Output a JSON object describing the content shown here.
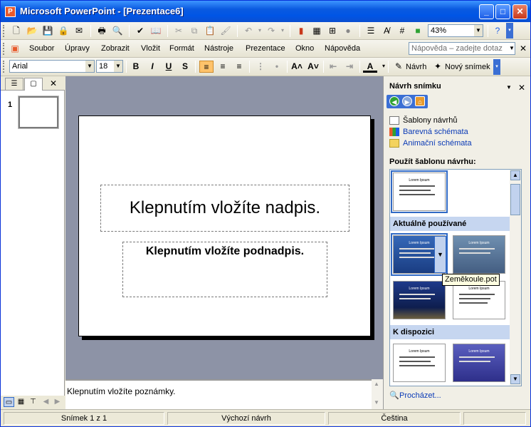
{
  "window": {
    "title": "Microsoft PowerPoint - [Prezentace6]",
    "app_icon": "P"
  },
  "standard_toolbar": {
    "zoom": "43%"
  },
  "menu": {
    "items": [
      "Soubor",
      "Úpravy",
      "Zobrazit",
      "Vložit",
      "Formát",
      "Nástroje",
      "Prezentace",
      "Okno",
      "Nápověda"
    ],
    "help_placeholder": "Nápověda – zadejte dotaz"
  },
  "format_toolbar": {
    "font": "Arial",
    "size": "18",
    "bold": "B",
    "italic": "I",
    "underline": "U",
    "shadow": "S",
    "design_label": "Návrh",
    "new_slide_label": "Nový snímek"
  },
  "slides_pane": {
    "slide_number": "1"
  },
  "slide": {
    "title_placeholder": "Klepnutím vložíte nadpis.",
    "subtitle_placeholder": "Klepnutím vložíte podnadpis."
  },
  "notes": {
    "placeholder": "Klepnutím vložíte poznámky."
  },
  "task_pane": {
    "title": "Návrh snímku",
    "links": [
      "Šablony návrhů",
      "Barevná schémata",
      "Animační schémata"
    ],
    "apply_label": "Použít šablonu návrhu:",
    "section_recent": "Aktuálně používané",
    "section_available": "K dispozici",
    "template_title": "Lorem Ipsum",
    "tooltip": "Zeměkoule.pot",
    "browse": "Procházet..."
  },
  "status": {
    "slide": "Snímek 1 z 1",
    "design": "Výchozí návrh",
    "language": "Čeština"
  },
  "colors": {
    "titlebar": "#0a5ae0",
    "canvas": "#8d93a6",
    "accent": "#316ac5",
    "highlight": "#ffc36b"
  }
}
